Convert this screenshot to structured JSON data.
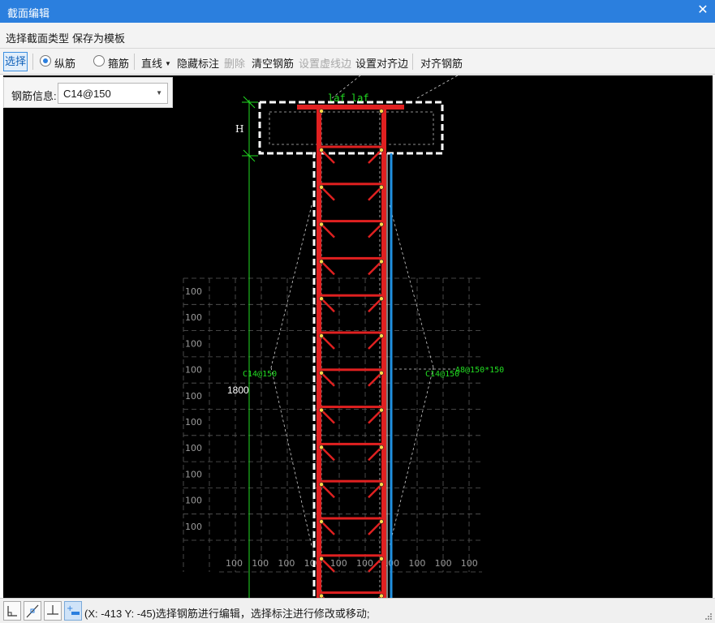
{
  "window": {
    "title": "截面编辑",
    "close_label": "✕"
  },
  "menu": {
    "select_type": "选择截面类型",
    "save_template": "保存为模板"
  },
  "toolbar": {
    "select": "选择",
    "longitudinal": "纵筋",
    "stirrup": "箍筋",
    "line": "直线",
    "hide_annotation": "隐藏标注",
    "delete": "删除",
    "clear_rebar": "清空钢筋",
    "set_dashed_edge": "设置虚线边",
    "set_align_edge": "设置对齐边",
    "align_rebar": "对齐钢筋",
    "longitudinal_checked": true,
    "stirrup_checked": false
  },
  "rebar_info": {
    "label": "钢筋信息:",
    "value": "C14@150"
  },
  "drawing": {
    "laf_label": "laf laf",
    "h_label": "H",
    "left_rebar_label": "C14@150",
    "right_rebar_label": "C14@150",
    "stirrup_label": "A8@150*150",
    "dim_1800": "1800",
    "grid_label": "100",
    "colors": {
      "rebar": "#e02020",
      "dim": "#22dd22",
      "outline": "#ffffff",
      "grid": "#5a5a5a",
      "edge": "#2090e0"
    }
  },
  "status": {
    "text": "(X: -413 Y: -45)选择钢筋进行编辑，选择标注进行修改或移动;",
    "buttons": [
      "ortho-icon",
      "snap-line-icon",
      "perpendicular-icon",
      "add-dimension-icon"
    ]
  }
}
